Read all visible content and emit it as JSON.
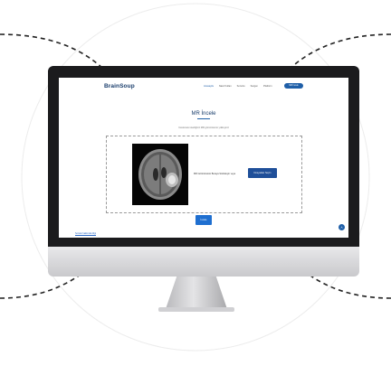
{
  "app": {
    "logo": "BrainSoup",
    "nav": {
      "items": [
        "Anasayfa",
        "Nasıl Kullan",
        "Sorunlu",
        "Sergen",
        "Platform"
      ],
      "active_index": 0,
      "cta": "MR İncele"
    },
    "page": {
      "title": "MR İncele",
      "subtitle": "Incelemek istediğiniz MR görüntüsünü yükleyiniz"
    },
    "upload": {
      "prompt": "MR Görüntüsünü Buraya Sürükleyin veya",
      "choose_button": "Dosyadan Seçin"
    },
    "analyze_button": "İncele",
    "footer_link": "Sorular hakkında bilgi",
    "fab_icon": "chevron-up-icon"
  },
  "colors": {
    "brand": "#183c6b",
    "accent": "#1f5fa8",
    "button": "#1f4f99"
  }
}
